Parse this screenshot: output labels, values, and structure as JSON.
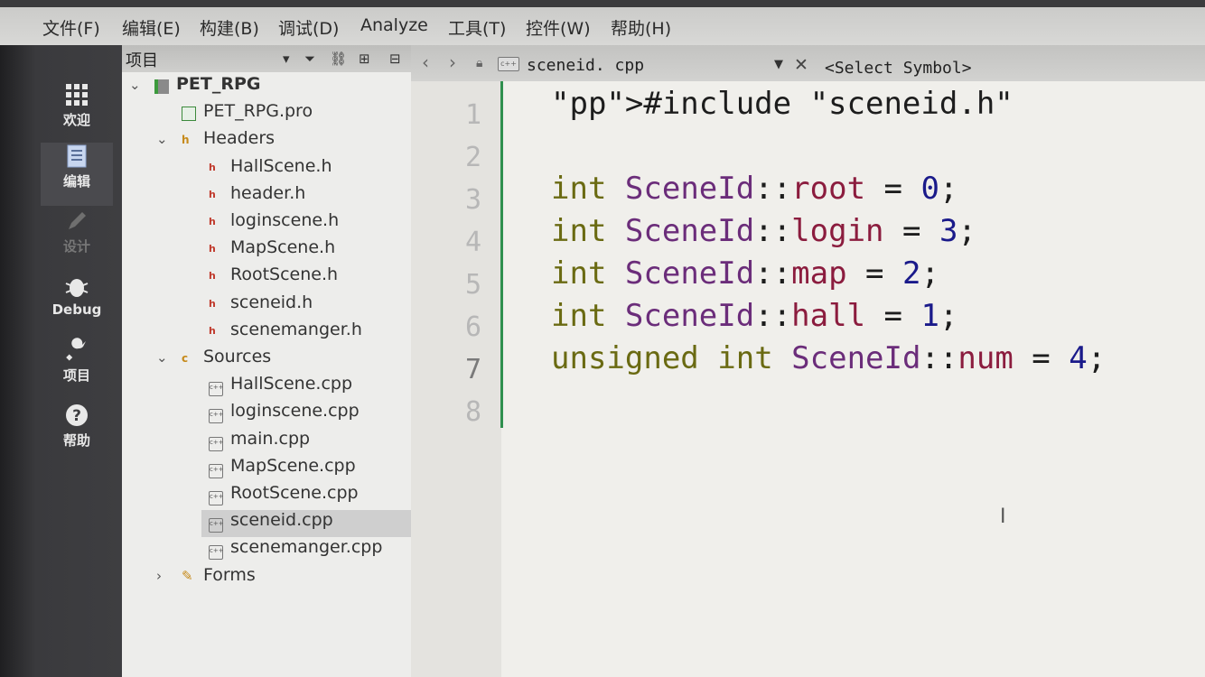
{
  "menu": [
    "文件(F)",
    "编辑(E)",
    "构建(B)",
    "调试(D)",
    "Analyze",
    "工具(T)",
    "控件(W)",
    "帮助(H)"
  ],
  "modes": [
    {
      "label": "欢迎",
      "icon": "grid-icon"
    },
    {
      "label": "编辑",
      "icon": "document-icon"
    },
    {
      "label": "设计",
      "icon": "pencil-icon"
    },
    {
      "label": "Debug",
      "icon": "bug-icon"
    },
    {
      "label": "项目",
      "icon": "wrench-icon"
    },
    {
      "label": "帮助",
      "icon": "help-icon"
    }
  ],
  "project_panel": {
    "title": "项目",
    "tree": [
      {
        "label": "PET_RPG",
        "depth": 0,
        "kind": "project",
        "expanded": true
      },
      {
        "label": "PET_RPG.pro",
        "depth": 1,
        "kind": "pro"
      },
      {
        "label": "Headers",
        "depth": 1,
        "kind": "folder-h",
        "expanded": true
      },
      {
        "label": "HallScene.h",
        "depth": 2,
        "kind": "h"
      },
      {
        "label": "header.h",
        "depth": 2,
        "kind": "h"
      },
      {
        "label": "loginscene.h",
        "depth": 2,
        "kind": "h"
      },
      {
        "label": "MapScene.h",
        "depth": 2,
        "kind": "h"
      },
      {
        "label": "RootScene.h",
        "depth": 2,
        "kind": "h"
      },
      {
        "label": "sceneid.h",
        "depth": 2,
        "kind": "h"
      },
      {
        "label": "scenemanger.h",
        "depth": 2,
        "kind": "h"
      },
      {
        "label": "Sources",
        "depth": 1,
        "kind": "folder-cpp",
        "expanded": true
      },
      {
        "label": "HallScene.cpp",
        "depth": 2,
        "kind": "cpp"
      },
      {
        "label": "loginscene.cpp",
        "depth": 2,
        "kind": "cpp"
      },
      {
        "label": "main.cpp",
        "depth": 2,
        "kind": "cpp"
      },
      {
        "label": "MapScene.cpp",
        "depth": 2,
        "kind": "cpp"
      },
      {
        "label": "RootScene.cpp",
        "depth": 2,
        "kind": "cpp"
      },
      {
        "label": "sceneid.cpp",
        "depth": 2,
        "kind": "cpp",
        "selected": true
      },
      {
        "label": "scenemanger.cpp",
        "depth": 2,
        "kind": "cpp"
      },
      {
        "label": "Forms",
        "depth": 1,
        "kind": "folder-forms",
        "expanded": false
      }
    ]
  },
  "editor": {
    "file_name": "sceneid. cpp",
    "symbol_selector": "<Select Symbol>",
    "current_line": 7,
    "line_numbers": [
      "1",
      "2",
      "3",
      "4",
      "5",
      "6",
      "7",
      "8"
    ],
    "lines": [
      "#include \"sceneid.h\"",
      "",
      "int SceneId::root = 0;",
      "int SceneId::login = 3;",
      "int SceneId::map = 2;",
      "int SceneId::hall = 1;",
      "unsigned int SceneId::num = 4;",
      ""
    ]
  }
}
